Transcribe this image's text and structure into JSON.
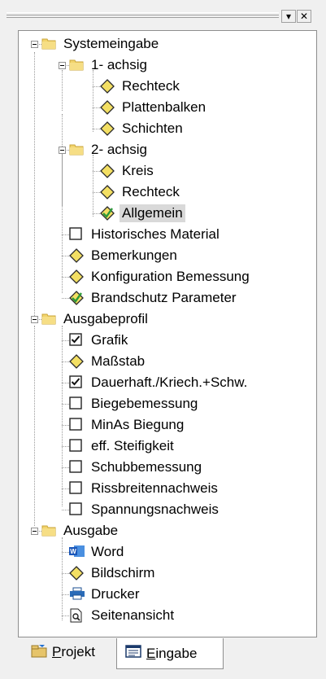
{
  "window": {
    "buttons": [
      "▾",
      "✕"
    ]
  },
  "tree": {
    "nodes": [
      {
        "label": "Systemeingabe",
        "icon": "folder"
      },
      {
        "label": "1- achsig",
        "icon": "folder"
      },
      {
        "label": "Rechteck",
        "icon": "diamond"
      },
      {
        "label": "Plattenbalken",
        "icon": "diamond"
      },
      {
        "label": "Schichten",
        "icon": "diamond"
      },
      {
        "label": "2- achsig",
        "icon": "folder"
      },
      {
        "label": "Kreis",
        "icon": "diamond"
      },
      {
        "label": "Rechteck",
        "icon": "diamond"
      },
      {
        "label": "Allgemein",
        "icon": "diamond-check"
      },
      {
        "label": "Historisches Material",
        "icon": "checkbox"
      },
      {
        "label": "Bemerkungen",
        "icon": "diamond"
      },
      {
        "label": "Konfiguration  Bemessung",
        "icon": "diamond"
      },
      {
        "label": "Brandschutz Parameter",
        "icon": "diamond-check"
      },
      {
        "label": "Ausgabeprofil",
        "icon": "folder"
      },
      {
        "label": "Grafik",
        "icon": "checkbox-checked"
      },
      {
        "label": "Maßstab",
        "icon": "diamond"
      },
      {
        "label": "Dauerhaft./Kriech.+Schw.",
        "icon": "checkbox-checked"
      },
      {
        "label": "Biegebemessung",
        "icon": "checkbox"
      },
      {
        "label": "MinAs Biegung",
        "icon": "checkbox"
      },
      {
        "label": "eff. Steifigkeit",
        "icon": "checkbox"
      },
      {
        "label": "Schubbemessung",
        "icon": "checkbox"
      },
      {
        "label": "Rissbreitennachweis",
        "icon": "checkbox"
      },
      {
        "label": "Spannungsnachweis",
        "icon": "checkbox"
      },
      {
        "label": "Ausgabe",
        "icon": "folder"
      },
      {
        "label": "Word",
        "icon": "word"
      },
      {
        "label": "Bildschirm",
        "icon": "diamond"
      },
      {
        "label": "Drucker",
        "icon": "printer"
      },
      {
        "label": "Seitenansicht",
        "icon": "preview"
      }
    ]
  },
  "tabs": [
    {
      "label": "Projekt",
      "underline": "P",
      "rest": "rojekt",
      "icon": "project-icon"
    },
    {
      "label": "Eingabe",
      "underline": "E",
      "rest": "ingabe",
      "icon": "input-icon"
    }
  ]
}
